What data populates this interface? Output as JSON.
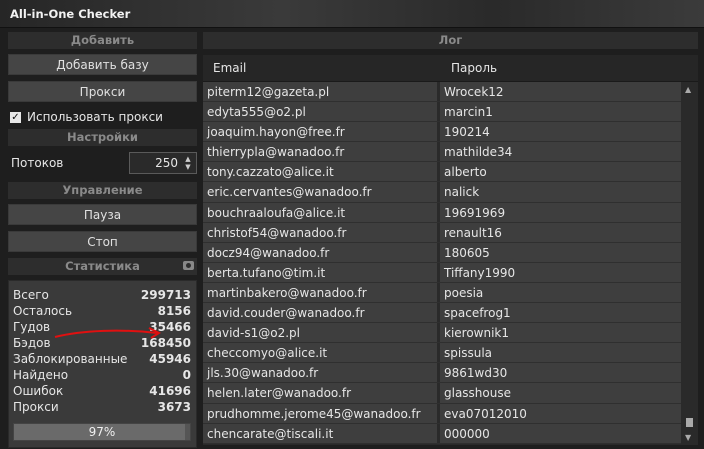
{
  "window": {
    "title": "All-in-One Checker"
  },
  "left": {
    "add_section": "Добавить",
    "add_base_button": "Добавить базу",
    "proxy_button": "Прокси",
    "use_proxy_label": "Использовать прокси",
    "use_proxy_checked": true,
    "settings_section": "Настройки",
    "threads_label": "Потоков",
    "threads_value": "250",
    "control_section": "Управление",
    "pause_button": "Пауза",
    "stop_button": "Стоп",
    "stats_section": "Статистика",
    "stats": [
      {
        "label": "Всего",
        "value": "299713"
      },
      {
        "label": "Осталось",
        "value": "8156"
      },
      {
        "label": "Гудов",
        "value": "35466"
      },
      {
        "label": "Бэдов",
        "value": "168450"
      },
      {
        "label": "Заблокированные",
        "value": "45946"
      },
      {
        "label": "Найдено",
        "value": "0"
      },
      {
        "label": "Ошибок",
        "value": "41696"
      },
      {
        "label": "Прокси",
        "value": "3673"
      }
    ],
    "progress_text": "97%",
    "progress_fraction": 0.97
  },
  "log": {
    "section": "Лог",
    "columns": {
      "email": "Email",
      "password": "Пароль"
    },
    "rows": [
      {
        "email": "piterm12@gazeta.pl",
        "password": "Wrocek12"
      },
      {
        "email": "edyta555@o2.pl",
        "password": "marcin1"
      },
      {
        "email": "joaquim.hayon@free.fr",
        "password": "190214"
      },
      {
        "email": "thierrypla@wanadoo.fr",
        "password": "mathilde34"
      },
      {
        "email": "tony.cazzato@alice.it",
        "password": "alberto"
      },
      {
        "email": "eric.cervantes@wanadoo.fr",
        "password": "nalick"
      },
      {
        "email": "bouchraaloufa@alice.it",
        "password": "19691969"
      },
      {
        "email": "christof54@wanadoo.fr",
        "password": "renault16"
      },
      {
        "email": "docz94@wanadoo.fr",
        "password": "180605"
      },
      {
        "email": "berta.tufano@tim.it",
        "password": "Tiffany1990"
      },
      {
        "email": "martinbakero@wanadoo.fr",
        "password": "poesia"
      },
      {
        "email": "david.couder@wanadoo.fr",
        "password": "spacefrog1"
      },
      {
        "email": "david-s1@o2.pl",
        "password": "kierownik1"
      },
      {
        "email": "checcomyo@alice.it",
        "password": "spissula"
      },
      {
        "email": "jls.30@wanadoo.fr",
        "password": "9861wd30"
      },
      {
        "email": "helen.later@wanadoo.fr",
        "password": "glasshouse"
      },
      {
        "email": "prudhomme.jerome45@wanadoo.fr",
        "password": "eva07012010"
      },
      {
        "email": "chencarate@tiscali.it",
        "password": "000000"
      }
    ]
  },
  "icons": {
    "camera": "camera-icon",
    "check": "check-icon"
  },
  "colors": {
    "annotation_arrow": "#e01010"
  }
}
